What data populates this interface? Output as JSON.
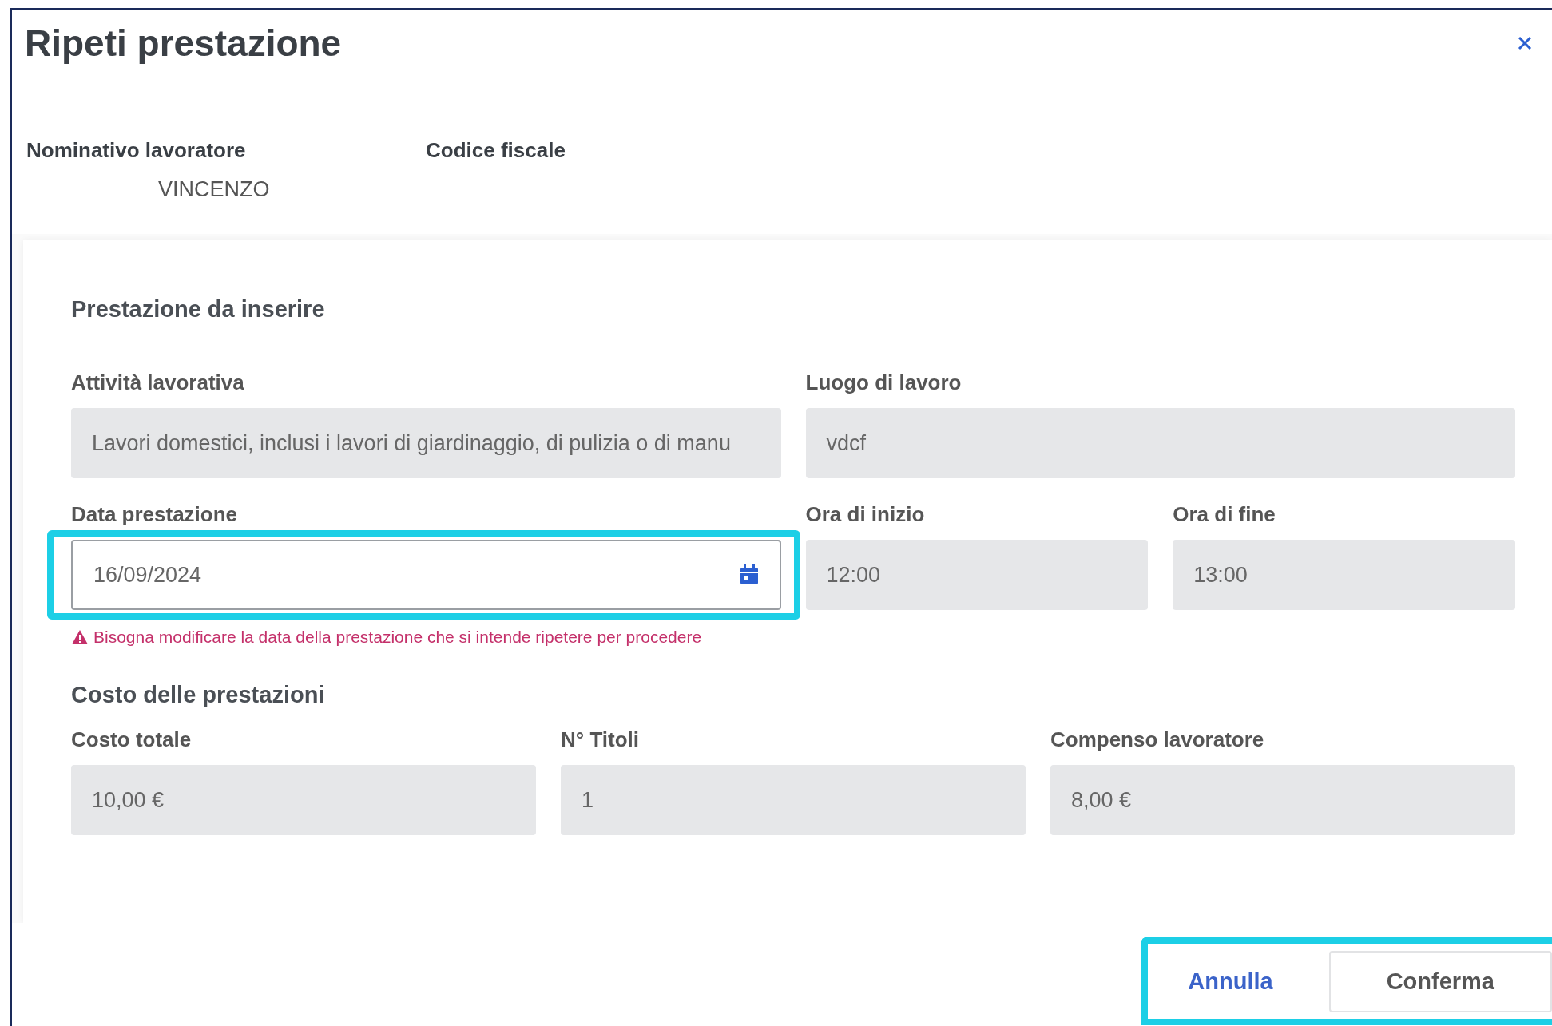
{
  "dialog": {
    "title": "Ripeti prestazione"
  },
  "worker": [
    {
      "label": "Nominativo lavoratore",
      "value": "VINCENZO"
    },
    {
      "label": "Codice fiscale"
    }
  ],
  "service": {
    "title": "Prestazione da inserire",
    "rows": [
      [
        {
          "label": "Attività lavorativa",
          "value": "Lavori domestici, inclusi i lavori di giardinaggio, di pulizia o di manu",
          "kind": "readonly"
        },
        {
          "label": "Luogo di lavoro",
          "value": "vdcf",
          "kind": "readonly"
        }
      ],
      [
        {
          "label": "Data prestazione",
          "value": "16/09/2024",
          "kind": "date",
          "highlighted": true,
          "error": "Bisogna modificare la data della prestazione che si intende ripetere per procedere"
        },
        {
          "label": "Ora di inizio",
          "value": "12:00",
          "kind": "readonly"
        },
        {
          "label": "Ora di fine",
          "value": "13:00",
          "kind": "readonly"
        }
      ]
    ]
  },
  "costs": {
    "title": "Costo delle prestazioni",
    "fields": [
      {
        "label": "Costo totale",
        "value": "10,00 €"
      },
      {
        "label": "N° Titoli",
        "value": "1"
      },
      {
        "label": "Compenso lavoratore",
        "value": "8,00 €"
      }
    ]
  },
  "footer": {
    "highlighted": true,
    "buttons": [
      {
        "label": "Annulla",
        "kind": "link"
      },
      {
        "label": "Conferma",
        "kind": "outline"
      }
    ]
  }
}
